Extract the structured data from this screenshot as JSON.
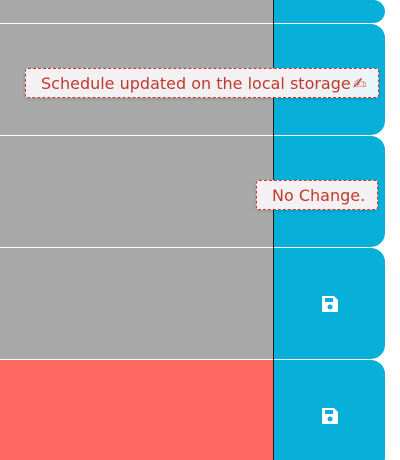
{
  "schedule": {
    "rows": [
      {
        "state": "normal",
        "button_icon": "floppy-disk-save-icon"
      },
      {
        "state": "normal",
        "button_icon": "floppy-disk-save-icon"
      },
      {
        "state": "normal",
        "button_icon": "floppy-disk-save-icon"
      },
      {
        "state": "normal",
        "button_icon": "floppy-disk-save-icon"
      },
      {
        "state": "error",
        "button_icon": "floppy-disk-save-icon"
      }
    ]
  },
  "notifications": {
    "saved": {
      "message": "Schedule updated on the local storage",
      "emoji": "✍"
    },
    "no_change": {
      "message": "No Change."
    }
  },
  "colors": {
    "row_normal": "#a9a9a9",
    "row_error": "#ff6961",
    "save_button": "#08afd8",
    "toast_text": "#c0392b",
    "toast_background": "#f3f1f4"
  }
}
